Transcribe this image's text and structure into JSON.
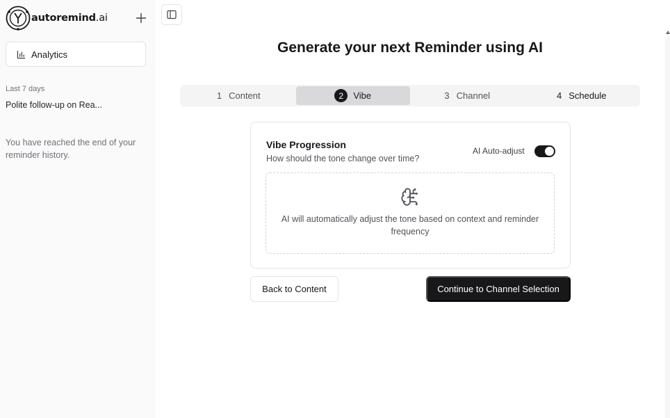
{
  "app": {
    "logo_text": "autoremind",
    "logo_suffix": ".ai"
  },
  "sidebar": {
    "analytics_label": "Analytics",
    "section_label": "Last 7 days",
    "history_items": [
      "Polite follow-up on Rea..."
    ],
    "end_message": "You have reached the end of your reminder history."
  },
  "main": {
    "title": "Generate your next Reminder using AI",
    "steps": [
      {
        "number": "1",
        "label": "Content"
      },
      {
        "number": "2",
        "label": "Vibe"
      },
      {
        "number": "3",
        "label": "Channel"
      },
      {
        "number": "4",
        "label": "Schedule"
      }
    ],
    "active_step": 2,
    "card": {
      "title": "Vibe Progression",
      "subtitle": "How should the tone change over time?",
      "toggle_label": "AI Auto-adjust",
      "toggle_on": true,
      "auto_text": "AI will automatically adjust the tone based on context and reminder frequency"
    },
    "back_button": "Back to Content",
    "continue_button": "Continue to Channel Selection"
  },
  "colors": {
    "primary": "#18181b",
    "sidebar_bg": "#fafafa",
    "border": "#e4e4e7",
    "muted": "#71717a"
  },
  "icons": [
    "logo-icon",
    "plus-icon",
    "bar-chart-icon",
    "sidebar-toggle-icon",
    "brain-icon"
  ]
}
